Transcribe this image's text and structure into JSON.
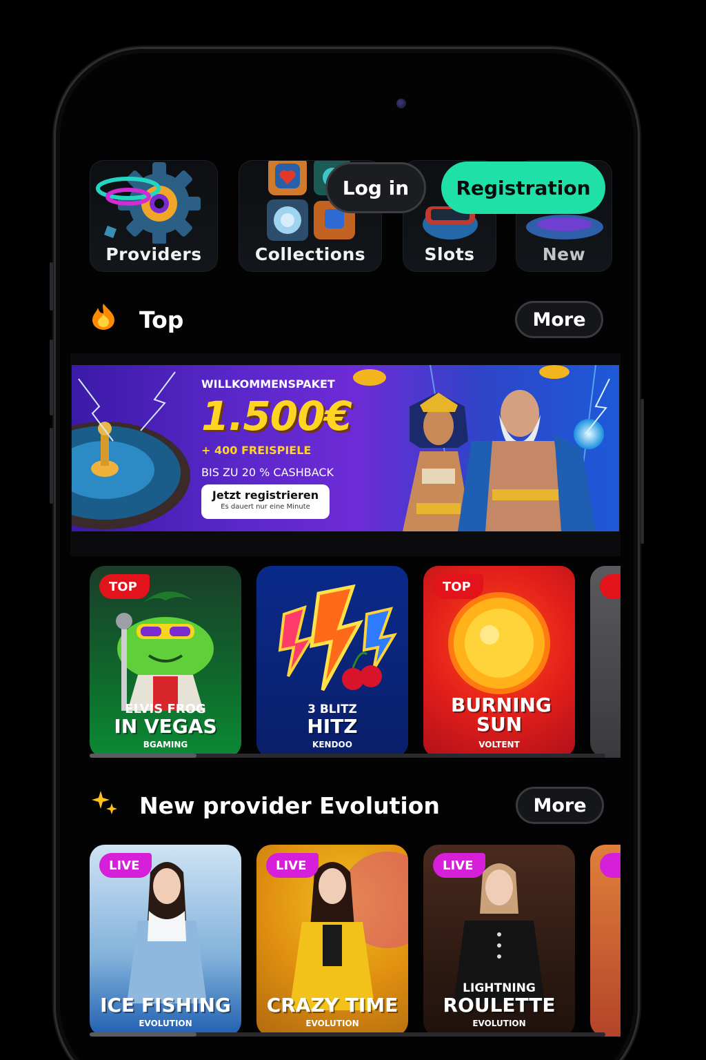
{
  "categories": [
    {
      "label": "Providers"
    },
    {
      "label": "Collections"
    },
    {
      "label": "Slots"
    },
    {
      "label": "New"
    }
  ],
  "auth": {
    "login": "Log in",
    "register": "Registration"
  },
  "top_section": {
    "title": "Top",
    "more": "More"
  },
  "banner": {
    "headline": "WILLKOMMENSPAKET",
    "amount": "1.500€",
    "free_spins": "+ 400 FREISPIELE",
    "cashback": "BIS ZU 20 % CASHBACK",
    "cta": "Jetzt registrieren",
    "cta_sub": "Es dauert nur eine Minute"
  },
  "top_games": [
    {
      "badge": "TOP",
      "subtitle": "ELVIS FROG",
      "title": "IN VEGAS",
      "provider": "BGAMING"
    },
    {
      "badge": "",
      "subtitle": "3 BLITZ",
      "title": "HITZ",
      "provider": "KENDOO"
    },
    {
      "badge": "TOP",
      "subtitle": "",
      "title": "BURNING SUN",
      "provider": "VOLTENT"
    }
  ],
  "evolution_section": {
    "title": "New provider Evolution",
    "more": "More"
  },
  "live_games": [
    {
      "badge": "LIVE",
      "subtitle": "",
      "title": "ICE FISHING",
      "provider": "EVOLUTION"
    },
    {
      "badge": "LIVE",
      "subtitle": "",
      "title": "CRAZY TIME",
      "provider": "EVOLUTION"
    },
    {
      "badge": "LIVE",
      "subtitle": "LIGHTNING",
      "title": "ROULETTE",
      "provider": "EVOLUTION"
    }
  ],
  "colors": {
    "accent": "#1fe0a6",
    "top_badge": "#e3131b",
    "live_badge": "#d61fd8"
  }
}
